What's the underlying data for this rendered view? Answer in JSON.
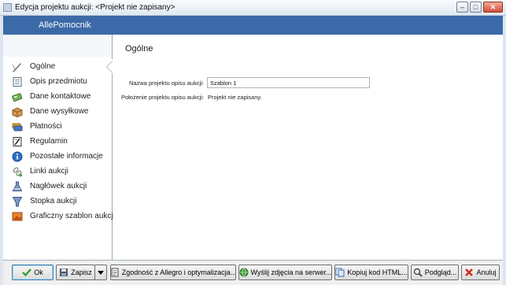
{
  "window": {
    "title": "Edycja projektu aukcji: <Projekt nie zapisany>"
  },
  "header": {
    "title": "AllePomocnik"
  },
  "sidebar": {
    "items": [
      {
        "label": "Ogólne",
        "icon": "pen-icon",
        "active": true
      },
      {
        "label": "Opis przedmiotu",
        "icon": "document-icon"
      },
      {
        "label": "Dane kontaktowe",
        "icon": "contact-card-icon"
      },
      {
        "label": "Dane wysyłkowe",
        "icon": "package-icon"
      },
      {
        "label": "Płatności",
        "icon": "payment-cards-icon"
      },
      {
        "label": "Regulamin",
        "icon": "rules-icon"
      },
      {
        "label": "Pozostałe informacje",
        "icon": "info-icon"
      },
      {
        "label": "Linki aukcji",
        "icon": "links-icon"
      },
      {
        "label": "Nagłówek aukcji",
        "icon": "header-flask-icon"
      },
      {
        "label": "Stopka aukcji",
        "icon": "footer-flask-icon"
      },
      {
        "label": "Graficzny szablon aukcji",
        "icon": "template-icon"
      }
    ]
  },
  "main": {
    "section_title": "Ogólne",
    "name_label": "Nazwa projektu opisu aukcji:",
    "name_value": "Szablon 1",
    "location_label": "Położenie projektu opisu aukcji:",
    "location_value": "Projekt nie zapisany."
  },
  "buttons": {
    "ok": "Ok",
    "save": "Zapisz",
    "compat": "Zgodność z Allegro i optymalizacja...",
    "upload": "Wyślij zdjęcia na serwer...",
    "copy_html": "Kopiuj kod HTML...",
    "preview": "Podgląd...",
    "cancel": "Anuluj"
  },
  "colors": {
    "header_band": "#3c6aa8",
    "accent_ok": "#3c7fb1"
  }
}
